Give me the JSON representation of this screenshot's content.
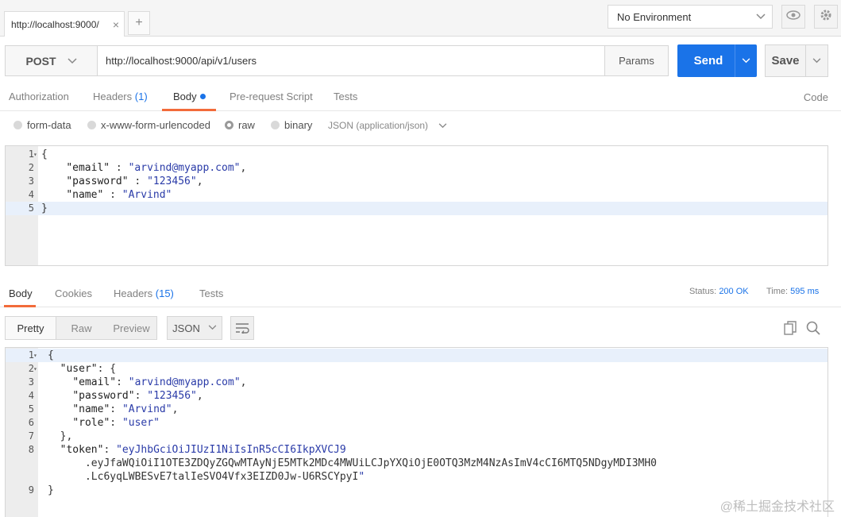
{
  "tabbar": {
    "active_tab": "http://localhost:9000/",
    "close_glyph": "×",
    "new_tab_glyph": "+",
    "environment": "No Environment",
    "icons": [
      "eye-icon",
      "gear-icon"
    ]
  },
  "request": {
    "method": "POST",
    "url": "http://localhost:9000/api/v1/users",
    "params_label": "Params",
    "send_label": "Send",
    "save_label": "Save"
  },
  "request_tabs": {
    "authorization": "Authorization",
    "headers": "Headers",
    "headers_count": "(1)",
    "body": "Body",
    "pre_request": "Pre-request Script",
    "tests": "Tests",
    "code": "Code"
  },
  "body_types": {
    "form_data": "form-data",
    "urlencoded": "x-www-form-urlencoded",
    "raw": "raw",
    "binary": "binary",
    "content_type": "JSON (application/json)",
    "selected": "raw"
  },
  "request_body": {
    "lines": [
      {
        "n": "1",
        "text": "{"
      },
      {
        "n": "2",
        "text": "    \"email\" : \"arvind@myapp.com\","
      },
      {
        "n": "3",
        "text": "    \"password\" : \"123456\","
      },
      {
        "n": "4",
        "text": "    \"name\" : \"Arvind\""
      },
      {
        "n": "5",
        "text": "}"
      }
    ]
  },
  "response_tabs": {
    "body": "Body",
    "cookies": "Cookies",
    "headers": "Headers",
    "headers_count": "(15)",
    "tests": "Tests",
    "status_label": "Status:",
    "status_value": "200 OK",
    "time_label": "Time:",
    "time_value": "595 ms"
  },
  "response_view": {
    "pretty": "Pretty",
    "raw": "Raw",
    "preview": "Preview",
    "format": "JSON",
    "icons": [
      "wrap-lines-icon",
      "copy-icon",
      "search-icon"
    ]
  },
  "response_body": {
    "lines": [
      {
        "n": "1",
        "text": "{"
      },
      {
        "n": "2",
        "text": "  \"user\": {"
      },
      {
        "n": "3",
        "text": "    \"email\": \"arvind@myapp.com\","
      },
      {
        "n": "4",
        "text": "    \"password\": \"123456\","
      },
      {
        "n": "5",
        "text": "    \"name\": \"Arvind\","
      },
      {
        "n": "6",
        "text": "    \"role\": \"user\""
      },
      {
        "n": "7",
        "text": "  },"
      },
      {
        "n": "8",
        "text": "  \"token\": \"eyJhbGciOiJIUzI1NiIsInR5cCI6IkpXVCJ9"
      },
      {
        "n": "",
        "text": "      .eyJfaWQiOiI1OTE3ZDQyZGQwMTAyNjE5MTk2MDc4MWUiLCJpYXQiOjE0OTQ3MzM4NzAsImV4cCI6MTQ5NDgyMDI3MH0"
      },
      {
        "n": "",
        "text": "      .Lc6yqLWBESvE7talIeSVO4Vfx3EIZD0Jw-U6RSCYpyI\""
      },
      {
        "n": "9",
        "text": "}"
      }
    ]
  },
  "watermark": "@稀土掘金技术社区",
  "colors": {
    "accent": "#1a73e8",
    "tab_underline": "#f26b3a"
  }
}
